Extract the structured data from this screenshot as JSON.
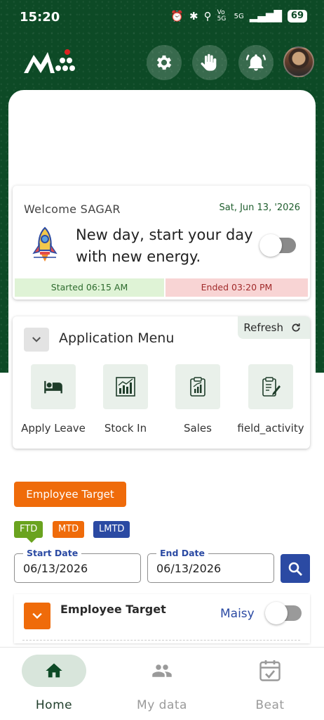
{
  "status_bar": {
    "time": "15:20",
    "network": "5G",
    "volte": "Vo 5G",
    "battery": "69"
  },
  "header": {
    "settings_icon": "gear-icon",
    "hand_icon": "hand-icon",
    "notifications_icon": "bell-icon",
    "colors": {
      "header_bg": "#0d4a26",
      "accent_orange": "#ef6b0a",
      "accent_blue": "#2b4aa3",
      "accent_green": "#6aa31f"
    }
  },
  "welcome": {
    "greeting": "Welcome SAGAR",
    "date": "Sat, Jun 13, '2026",
    "motto": "New day, start your day with new energy.",
    "started": "Started 06:15 AM",
    "ended": "Ended 03:20 PM",
    "day_toggle_on": false
  },
  "app_menu": {
    "title": "Application Menu",
    "refresh_label": "Refresh",
    "items": [
      {
        "label": "Apply Leave",
        "icon": "bed-icon"
      },
      {
        "label": "Stock In",
        "icon": "bar-chart-icon"
      },
      {
        "label": "Sales",
        "icon": "clipboard-chart-icon"
      },
      {
        "label": "field_activity",
        "icon": "clipboard-edit-icon"
      }
    ]
  },
  "target": {
    "button_label": "Employee Target",
    "chips": [
      "FTD",
      "MTD",
      "LMTD"
    ],
    "start_date_label": "Start Date",
    "start_date_value": "06/13/2026",
    "end_date_label": "End Date",
    "end_date_value": "06/13/2026",
    "row_title": "Employee Target",
    "row_name": "Maisy"
  },
  "bottom_nav": {
    "items": [
      {
        "label": "Home",
        "icon": "home-icon",
        "active": true
      },
      {
        "label": "My data",
        "icon": "people-icon",
        "active": false
      },
      {
        "label": "Beat",
        "icon": "calendar-check-icon",
        "active": false
      }
    ]
  }
}
